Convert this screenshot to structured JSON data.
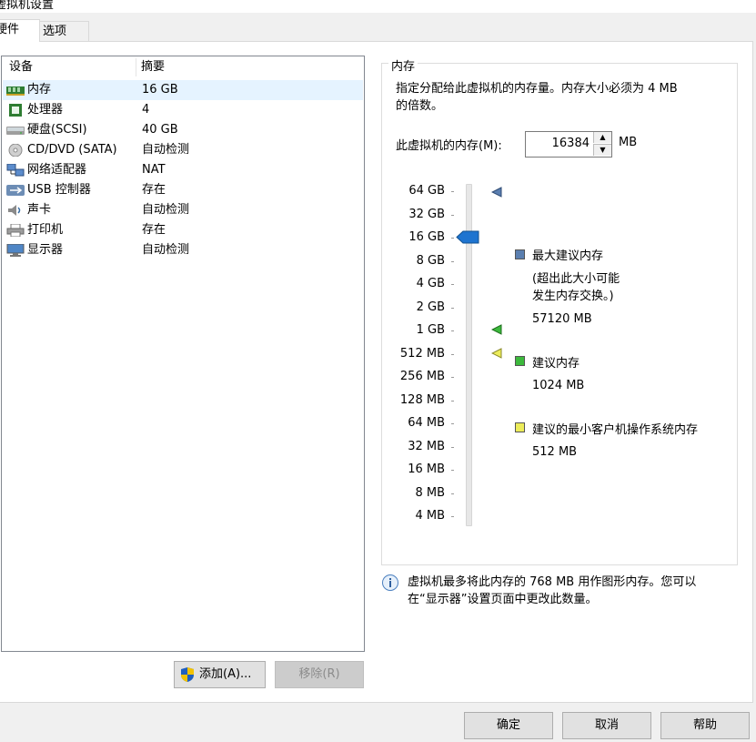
{
  "window": {
    "title": "虚拟机设置",
    "close_icon": "close-icon"
  },
  "tabs": [
    {
      "label": "硬件"
    },
    {
      "label": "选项"
    }
  ],
  "devices": {
    "col_device": "设备",
    "col_summary": "摘要",
    "items": [
      {
        "name": "内存",
        "summary": "16 GB",
        "icon": "memory-icon"
      },
      {
        "name": "处理器",
        "summary": "4",
        "icon": "cpu-icon"
      },
      {
        "name": "硬盘(SCSI)",
        "summary": "40 GB",
        "icon": "harddisk-icon"
      },
      {
        "name": "CD/DVD (SATA)",
        "summary": "自动检测",
        "icon": "cd-dvd-icon"
      },
      {
        "name": "网络适配器",
        "summary": "NAT",
        "icon": "network-adapter-icon"
      },
      {
        "name": "USB 控制器",
        "summary": "存在",
        "icon": "usb-icon"
      },
      {
        "name": "声卡",
        "summary": "自动检测",
        "icon": "sound-card-icon"
      },
      {
        "name": "打印机",
        "summary": "存在",
        "icon": "printer-icon"
      },
      {
        "name": "显示器",
        "summary": "自动检测",
        "icon": "display-icon"
      }
    ]
  },
  "buttons": {
    "add": "添加(A)...",
    "remove": "移除(R)",
    "ok": "确定",
    "cancel": "取消",
    "help": "帮助"
  },
  "memory": {
    "group_title": "内存",
    "desc_line1": "指定分配给此虚拟机的内存量。内存大小必须为 4 MB",
    "desc_line2": "的倍数。",
    "field_label": "此虚拟机的内存(M):",
    "value": "16384",
    "unit": "MB",
    "scale": [
      "64 GB",
      "32 GB",
      "16 GB",
      "8 GB",
      "4 GB",
      "2 GB",
      "1 GB",
      "512 MB",
      "256 MB",
      "128 MB",
      "64 MB",
      "32 MB",
      "16 MB",
      "8 MB",
      "4 MB"
    ],
    "selected_level": "16 GB",
    "max_label": "最大建议内存",
    "max_note1": "(超出此大小可能",
    "max_note2": "发生内存交换。)",
    "max_value": "57120 MB",
    "rec_label": "建议内存",
    "rec_value": "1024 MB",
    "min_label": "建议的最小客户机操作系统内存",
    "min_value": "512 MB",
    "colors": {
      "max": "#5b7fb0",
      "rec": "#3cb93c",
      "min": "#ecec5a",
      "thumb": "#1e74d0"
    }
  },
  "info": {
    "line1": "虚拟机最多将此内存的 768 MB 用作图形内存。您可以",
    "line2": "在“显示器”设置页面中更改此数量。"
  }
}
